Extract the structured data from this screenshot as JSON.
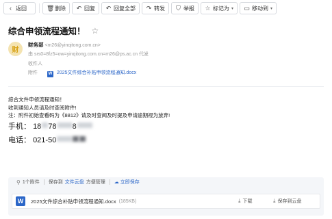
{
  "toolbar": {
    "back": "返回",
    "delete": "删除",
    "reply": "回复",
    "reply_all": "回复全部",
    "forward": "转发",
    "report": "举报",
    "mark_as": "标记为",
    "move_to": "移动到"
  },
  "mail": {
    "subject": "综合申领流程通知！",
    "avatar_char": "财",
    "sender_name": "财务部",
    "sender_email": "<m26@yinqitong.com.cn>",
    "sender_proxy": "由 srs0=8fz5=ow=yinqitong.com.cn=m26@ps.ac.cn 代发",
    "recipient_label": "收件人",
    "attachment_label": "附件",
    "attachment_link": "2025文件综合补贴申领流程通知.docx"
  },
  "body": {
    "line1": "综合文件申领流程通知！",
    "line2": "收到通知人员请及时查阅附件!",
    "line3": "注：附件初始查看码为《8812》请及时查阅及时提及申请逾期视为放弃!",
    "phone_label": "手机：",
    "phone_visible_a": "18",
    "phone_visible_b": "78",
    "phone_visible_c": "8",
    "tel_label": "电话：",
    "tel_visible": "021-50"
  },
  "attachments": {
    "count_label": "1个附件",
    "save_to": "保存到",
    "cloud_disk": "文件云盘",
    "manage": "方便管理",
    "save_now": "立即保存",
    "file_name": "2025文件综合补贴申领流程通知.docx",
    "file_size": "(185KB)",
    "download": "下载",
    "save_cloud": "保存到云盘"
  },
  "icons": {
    "back": "chevron-left-icon",
    "delete": "trash-icon",
    "reply": "reply-icon",
    "reply_all": "reply-all-icon",
    "forward": "forward-icon",
    "report": "shield-icon",
    "mark_as": "star-icon",
    "move_to": "folder-icon",
    "word": "word-file-icon",
    "paperclip": "paperclip-icon"
  },
  "colors": {
    "link_blue": "#2b66c8",
    "avatar_bg": "#f4e3b0",
    "avatar_fg": "#d8a318",
    "attach_bg": "#f4f6f9"
  }
}
